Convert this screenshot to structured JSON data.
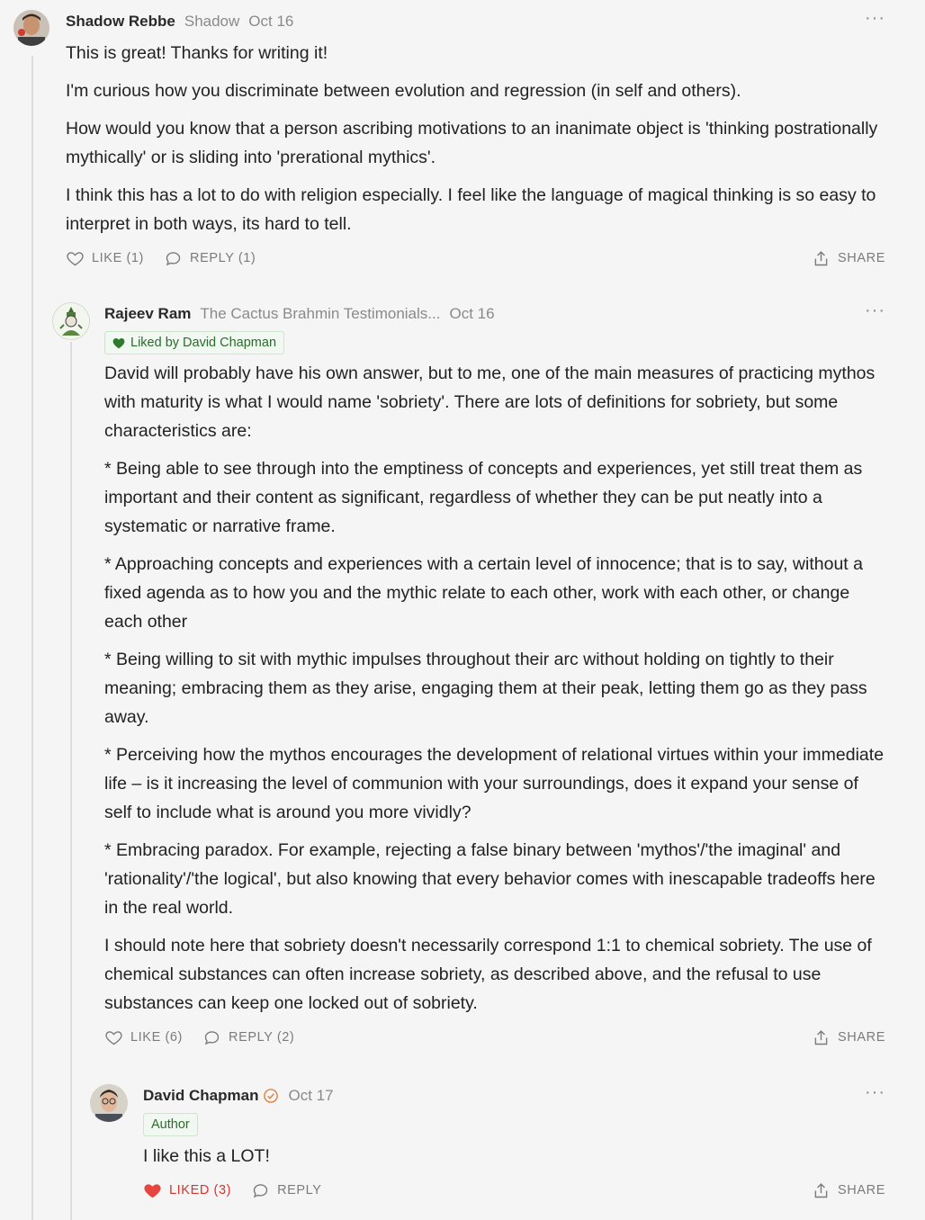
{
  "comments": [
    {
      "author": "Shadow Rebbe",
      "publication": "Shadow",
      "date": "Oct 16",
      "more": "···",
      "paragraphs": [
        "This is great! Thanks for writing it!",
        "I'm curious how you discriminate between evolution and regression (in self and others).",
        "How would you know that a person ascribing motivations to an inanimate object is 'thinking postrationally mythically' or is sliding into 'prerational mythics'.",
        "I think this has a lot to do with religion especially. I feel like the language of magical thinking is so easy to interpret in both ways, its hard to tell."
      ],
      "like_label": "LIKE (1)",
      "reply_label": "REPLY (1)",
      "share_label": "SHARE"
    },
    {
      "author": "Rajeev Ram",
      "publication": "The Cactus Brahmin Testimonials...",
      "date": "Oct 16",
      "more": "···",
      "badge": "Liked by David Chapman",
      "paragraphs": [
        "David will probably have his own answer, but to me, one of the main measures of practicing mythos with maturity is what I would name 'sobriety'. There are lots of definitions for sobriety, but some characteristics are:",
        "* Being able to see through into the emptiness of concepts and experiences, yet still treat them as important and their content as significant, regardless of whether they can be put neatly into a systematic or narrative frame.",
        "* Approaching concepts and experiences with a certain level of innocence; that is to say, without a fixed agenda as to how you and the mythic relate to each other, work with each other, or change each other",
        "* Being willing to sit with mythic impulses throughout their arc without holding on tightly to their meaning; embracing them as they arise, engaging them at their peak, letting them go as they pass away.",
        "* Perceiving how the mythos encourages the development of relational virtues within your immediate life – is it increasing the level of communion with your surroundings, does it expand your sense of self to include what is around you more vividly?",
        "* Embracing paradox. For example, rejecting a false binary between 'mythos'/'the imaginal' and 'rationality'/'the logical', but also knowing that every behavior comes with inescapable tradeoffs here in the real world.",
        "I should note here that sobriety doesn't necessarily correspond 1:1 to chemical sobriety. The use of chemical substances can often increase sobriety, as described above, and the refusal to use substances can keep one locked out of sobriety."
      ],
      "like_label": "LIKE (6)",
      "reply_label": "REPLY (2)",
      "share_label": "SHARE"
    },
    {
      "author": "David Chapman",
      "date": "Oct 17",
      "more": "···",
      "badge": "Author",
      "paragraphs": [
        "I like this a LOT!"
      ],
      "like_label": "LIKED (3)",
      "reply_label": "REPLY",
      "share_label": "SHARE"
    }
  ],
  "colors": {
    "liked": "#d9332f",
    "badge_green": "#2d6b2d",
    "verified": "#e07a3a"
  }
}
